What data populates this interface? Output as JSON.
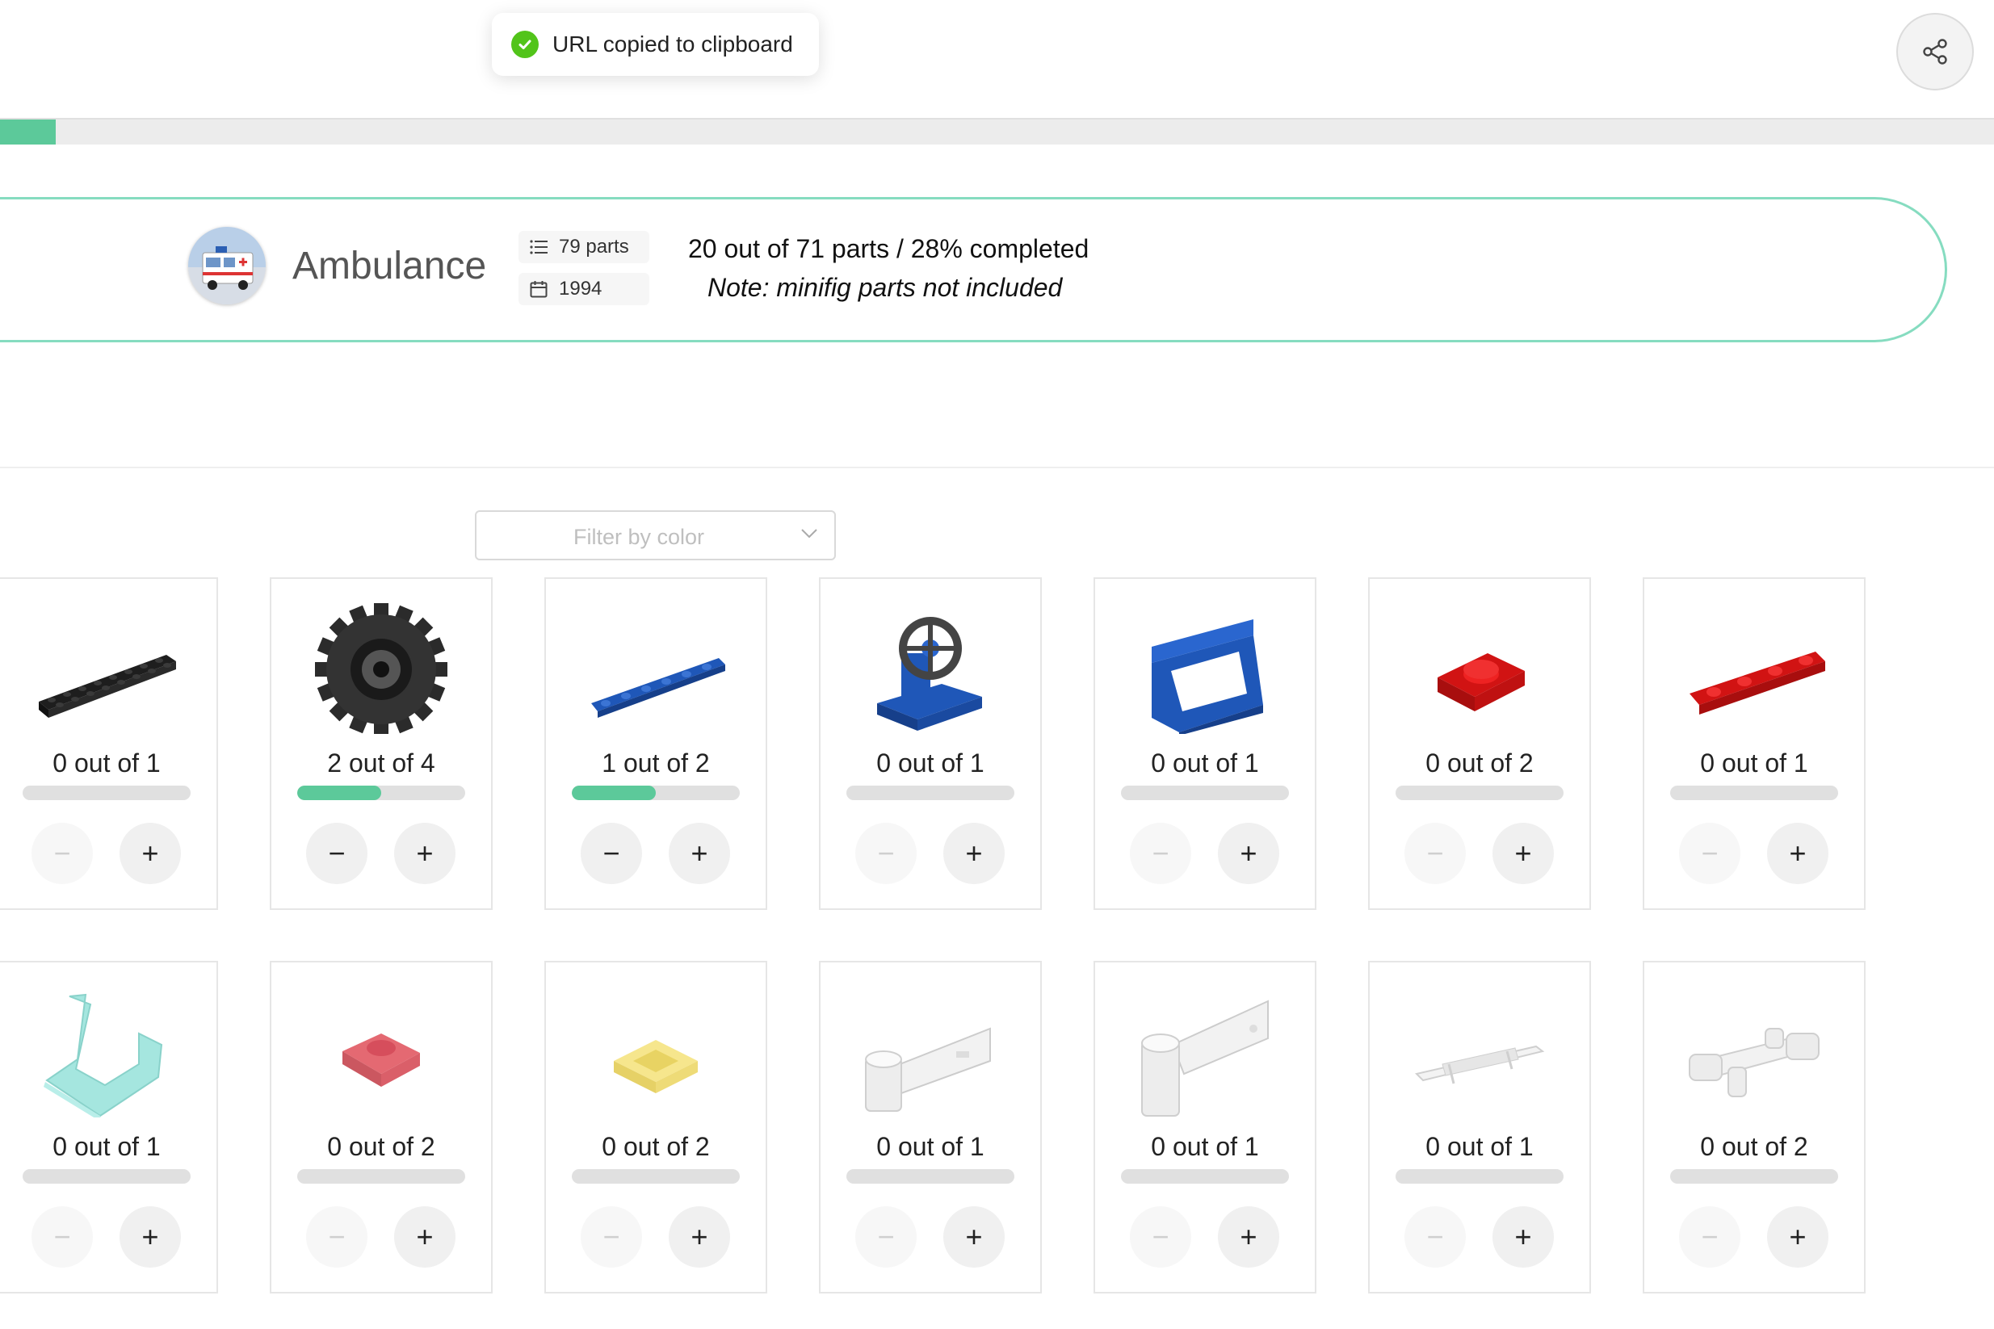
{
  "toast": {
    "message": "URL copied to clipboard",
    "icon": "check-circle-icon"
  },
  "share": {
    "icon": "share-icon"
  },
  "progress": {
    "fraction": 0.028,
    "color": "#5cc99a"
  },
  "set": {
    "name": "Ambulance",
    "parts_count": "79 parts",
    "year": "1994",
    "summary": "20 out of 71 parts / 28% completed",
    "note": "Note: minifig parts not included"
  },
  "filter": {
    "placeholder": "Filter by color"
  },
  "parts": [
    {
      "label": "0 out of 1",
      "have": 0,
      "need": 1,
      "part": "black-plate-2x8"
    },
    {
      "label": "2 out of 4",
      "have": 2,
      "need": 4,
      "part": "black-tire"
    },
    {
      "label": "1 out of 2",
      "have": 1,
      "need": 2,
      "part": "blue-plate-1x6"
    },
    {
      "label": "0 out of 1",
      "have": 0,
      "need": 1,
      "part": "blue-steering-wheel-stand"
    },
    {
      "label": "0 out of 1",
      "have": 0,
      "need": 1,
      "part": "blue-tile-handle"
    },
    {
      "label": "0 out of 2",
      "have": 0,
      "need": 2,
      "part": "red-plate-2x2"
    },
    {
      "label": "0 out of 1",
      "have": 0,
      "need": 1,
      "part": "red-plate-1x4"
    },
    {
      "label": "0 out of 1",
      "have": 0,
      "need": 1,
      "part": "trans-light-blue-windscreen"
    },
    {
      "label": "0 out of 2",
      "have": 0,
      "need": 2,
      "part": "trans-red-tile-1x1"
    },
    {
      "label": "0 out of 2",
      "have": 0,
      "need": 2,
      "part": "trans-yellow-tile-1x1"
    },
    {
      "label": "0 out of 1",
      "have": 0,
      "need": 1,
      "part": "white-door-hinge"
    },
    {
      "label": "0 out of 1",
      "have": 0,
      "need": 1,
      "part": "white-door-hinge-tall"
    },
    {
      "label": "0 out of 1",
      "have": 0,
      "need": 1,
      "part": "white-stretcher"
    },
    {
      "label": "0 out of 2",
      "have": 0,
      "need": 2,
      "part": "white-axle-holder"
    }
  ],
  "buttons": {
    "minus": "−",
    "plus": "+"
  }
}
